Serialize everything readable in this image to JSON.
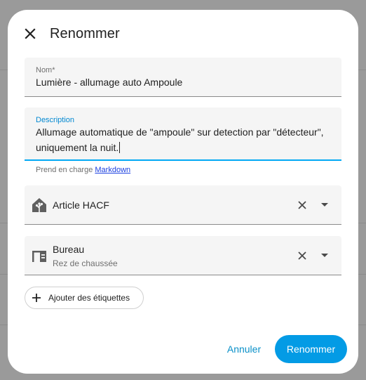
{
  "dialog": {
    "title": "Renommer",
    "close_icon": "close-icon"
  },
  "name_field": {
    "label": "Nom*",
    "value": "Lumière - allumage auto Ampoule"
  },
  "description_field": {
    "label": "Description",
    "value": "Allumage automatique de \"ampoule\" sur detection par \"détecteur\", uniquement la nuit."
  },
  "helper": {
    "prefix": "Prend en charge ",
    "link": "Markdown"
  },
  "area_picker": {
    "icon": "home-assistant-icon",
    "value": "Article HACF"
  },
  "floor_picker": {
    "icon": "desk-icon",
    "value": "Bureau",
    "sublabel": "Rez de chaussée"
  },
  "labels_chip": {
    "icon": "plus-icon",
    "label": "Ajouter des étiquettes"
  },
  "actions": {
    "cancel_label": "Annuler",
    "rename_label": "Renommer"
  },
  "colors": {
    "accent": "#039be5",
    "link": "#1a3fe0",
    "backdrop": "#9a9a9a"
  }
}
